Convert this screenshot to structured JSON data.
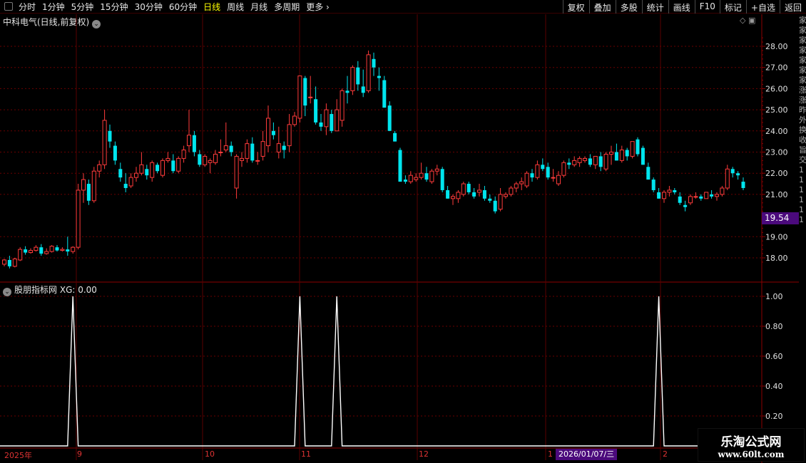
{
  "toolbar": {
    "periods": [
      "分时",
      "1分钟",
      "5分钟",
      "15分钟",
      "30分钟",
      "60分钟",
      "日线",
      "周线",
      "月线",
      "多周期"
    ],
    "active_period": "日线",
    "more_label": "更多",
    "more_icon": "chevron-right-icon",
    "buttons": [
      "复权",
      "叠加",
      "多股",
      "统计",
      "画线",
      "F10",
      "标记",
      "+自选",
      "返回"
    ]
  },
  "main_chart": {
    "title": "中科电气(日线,前复权)",
    "y_ticks": [
      "28.00",
      "27.00",
      "26.00",
      "25.00",
      "24.00",
      "23.00",
      "22.00",
      "21.00",
      "19.00",
      "18.00"
    ],
    "current_price": "19.54",
    "colors": {
      "up": "#ff3b3b",
      "down": "#00e5ee",
      "grid": "#6a0000",
      "price_badge": "#4b0a7c"
    }
  },
  "indicator": {
    "title": "股朋指标网",
    "value_label": "XG: 0.00",
    "y_ticks": [
      "1.00",
      "0.80",
      "0.60",
      "0.40",
      "0.20"
    ],
    "line_color": "#ffffff"
  },
  "x_axis": {
    "labels": [
      "2025年",
      "9",
      "10",
      "11",
      "12",
      "1",
      "2"
    ],
    "crosshair_date": "2026/01/07/三"
  },
  "right_strip": [
    "家",
    "家",
    "家",
    "家",
    "家",
    "家",
    "家",
    "涨",
    "涨",
    "昨",
    "外",
    "换",
    "收",
    "旨",
    "交",
    "1",
    "1",
    "1",
    "1",
    "1",
    "1"
  ],
  "watermark": {
    "title": "乐淘公式网",
    "url": "www.60lt.com"
  },
  "chart_data": [
    {
      "type": "candlestick",
      "title": "中科电气(日线,前复权)",
      "ylim": [
        17.5,
        28.5
      ],
      "y_ticks": [
        28,
        27,
        26,
        25,
        24,
        23,
        22,
        21,
        19,
        18
      ],
      "x_labels": [
        "2025年",
        "9",
        "10",
        "11",
        "12",
        "1",
        "2"
      ],
      "last_price": 19.54,
      "ohlc": [
        [
          17.7,
          17.95,
          17.6,
          17.9
        ],
        [
          17.9,
          18.1,
          17.5,
          17.6
        ],
        [
          17.6,
          18.0,
          17.55,
          17.95
        ],
        [
          17.9,
          18.5,
          17.85,
          18.4
        ],
        [
          18.4,
          18.55,
          18.15,
          18.25
        ],
        [
          18.25,
          18.45,
          18.2,
          18.35
        ],
        [
          18.35,
          18.6,
          18.3,
          18.5
        ],
        [
          18.5,
          18.65,
          18.1,
          18.2
        ],
        [
          18.2,
          18.45,
          18.15,
          18.3
        ],
        [
          18.3,
          18.6,
          18.25,
          18.55
        ],
        [
          18.5,
          18.6,
          18.3,
          18.35
        ],
        [
          18.35,
          18.5,
          18.3,
          18.4
        ],
        [
          18.4,
          19.0,
          18.1,
          18.3
        ],
        [
          18.3,
          18.55,
          18.2,
          18.5
        ],
        [
          18.5,
          21.5,
          18.4,
          21.2
        ],
        [
          21.2,
          22.0,
          20.6,
          21.7
        ],
        [
          21.5,
          21.7,
          20.5,
          20.7
        ],
        [
          20.7,
          22.3,
          20.6,
          22.1
        ],
        [
          22.1,
          22.6,
          21.8,
          22.4
        ],
        [
          22.4,
          25.0,
          22.2,
          24.5
        ],
        [
          24.0,
          24.3,
          23.2,
          23.5
        ],
        [
          23.3,
          23.5,
          22.4,
          22.6
        ],
        [
          22.2,
          22.5,
          21.6,
          21.8
        ],
        [
          21.5,
          22.0,
          21.1,
          21.3
        ],
        [
          21.4,
          22.0,
          21.3,
          21.8
        ],
        [
          21.8,
          22.3,
          21.6,
          22.0
        ],
        [
          22.0,
          23.0,
          21.9,
          22.4
        ],
        [
          22.2,
          22.4,
          21.7,
          21.9
        ],
        [
          21.8,
          22.6,
          21.6,
          22.5
        ],
        [
          22.4,
          22.5,
          22.0,
          22.1
        ],
        [
          21.9,
          22.7,
          21.8,
          22.6
        ],
        [
          22.6,
          23.0,
          22.5,
          22.7
        ],
        [
          22.6,
          22.9,
          22.0,
          22.1
        ],
        [
          22.1,
          22.8,
          22.0,
          22.7
        ],
        [
          22.7,
          23.3,
          22.5,
          23.1
        ],
        [
          23.3,
          25.0,
          23.0,
          23.8
        ],
        [
          23.8,
          24.0,
          22.8,
          23.0
        ],
        [
          22.9,
          23.1,
          22.3,
          22.4
        ],
        [
          22.4,
          22.9,
          22.3,
          22.8
        ],
        [
          22.5,
          22.7,
          22.0,
          22.6
        ],
        [
          22.5,
          23.1,
          22.4,
          22.9
        ],
        [
          23.0,
          23.6,
          22.8,
          23.0
        ],
        [
          23.1,
          24.4,
          23.0,
          23.3
        ],
        [
          23.3,
          23.5,
          22.8,
          23.0
        ],
        [
          21.3,
          22.9,
          20.8,
          22.8
        ],
        [
          22.6,
          23.0,
          22.3,
          22.7
        ],
        [
          22.7,
          23.6,
          22.5,
          23.4
        ],
        [
          23.4,
          23.7,
          22.5,
          22.6
        ],
        [
          22.6,
          23.0,
          22.4,
          22.6
        ],
        [
          22.8,
          24.0,
          22.6,
          23.5
        ],
        [
          23.3,
          25.2,
          23.0,
          24.6
        ],
        [
          24.0,
          24.4,
          23.6,
          23.8
        ],
        [
          23.0,
          24.2,
          22.7,
          23.4
        ],
        [
          23.3,
          23.5,
          22.7,
          23.1
        ],
        [
          23.3,
          24.8,
          23.0,
          24.3
        ],
        [
          24.3,
          24.9,
          24.2,
          24.7
        ],
        [
          24.6,
          26.6,
          24.4,
          26.6
        ],
        [
          26.5,
          26.6,
          24.7,
          25.2
        ],
        [
          25.6,
          26.6,
          25.3,
          25.6
        ],
        [
          25.5,
          26.1,
          24.3,
          24.4
        ],
        [
          24.4,
          24.8,
          24.0,
          24.2
        ],
        [
          24.2,
          25.3,
          23.8,
          25.0
        ],
        [
          24.8,
          25.0,
          23.9,
          24.0
        ],
        [
          24.0,
          25.5,
          24.3,
          25.0
        ],
        [
          24.5,
          26.0,
          24.2,
          25.9
        ],
        [
          25.9,
          26.6,
          25.3,
          25.8
        ],
        [
          25.9,
          27.1,
          25.7,
          27.0
        ],
        [
          27.0,
          27.3,
          25.9,
          26.2
        ],
        [
          26.1,
          26.9,
          25.6,
          25.8
        ],
        [
          25.9,
          27.8,
          25.8,
          27.6
        ],
        [
          27.4,
          27.7,
          26.6,
          27.0
        ],
        [
          26.6,
          27.0,
          25.9,
          26.5
        ],
        [
          26.4,
          26.6,
          25.1,
          25.1
        ],
        [
          25.2,
          25.4,
          24.0,
          24.0
        ],
        [
          23.9,
          24.0,
          23.5,
          23.5
        ],
        [
          23.1,
          23.2,
          21.6,
          21.6
        ],
        [
          21.7,
          21.9,
          21.5,
          21.6
        ],
        [
          21.6,
          22.1,
          21.5,
          21.9
        ],
        [
          21.7,
          22.0,
          21.6,
          21.8
        ],
        [
          21.8,
          22.5,
          21.7,
          22.0
        ],
        [
          22.0,
          22.3,
          21.6,
          21.7
        ],
        [
          21.6,
          22.2,
          21.5,
          22.1
        ],
        [
          22.1,
          22.4,
          21.9,
          22.2
        ],
        [
          22.2,
          22.3,
          21.1,
          21.2
        ],
        [
          21.2,
          21.4,
          20.8,
          20.8
        ],
        [
          20.8,
          21.0,
          20.5,
          20.9
        ],
        [
          20.8,
          21.2,
          20.6,
          21.1
        ],
        [
          21.0,
          21.6,
          20.9,
          21.5
        ],
        [
          21.5,
          21.6,
          21.0,
          21.1
        ],
        [
          21.1,
          21.3,
          20.8,
          20.9
        ],
        [
          21.1,
          21.5,
          20.9,
          21.2
        ],
        [
          21.2,
          21.4,
          20.7,
          20.8
        ],
        [
          20.8,
          21.0,
          20.6,
          20.7
        ],
        [
          20.7,
          20.9,
          20.1,
          20.2
        ],
        [
          20.3,
          21.3,
          20.2,
          21.0
        ],
        [
          20.9,
          21.1,
          20.8,
          21.0
        ],
        [
          21.0,
          21.4,
          20.9,
          21.3
        ],
        [
          21.3,
          21.6,
          21.1,
          21.5
        ],
        [
          21.5,
          21.8,
          21.2,
          21.6
        ],
        [
          21.4,
          22.1,
          21.3,
          22.0
        ],
        [
          22.0,
          22.2,
          21.6,
          21.8
        ],
        [
          21.8,
          22.6,
          21.7,
          22.4
        ],
        [
          22.4,
          22.7,
          22.1,
          22.2
        ],
        [
          22.3,
          22.5,
          21.7,
          21.8
        ],
        [
          21.8,
          22.2,
          21.6,
          21.8
        ],
        [
          21.5,
          22.1,
          21.4,
          21.9
        ],
        [
          21.9,
          22.6,
          21.8,
          22.5
        ],
        [
          22.5,
          22.7,
          22.2,
          22.4
        ],
        [
          22.4,
          22.8,
          22.3,
          22.6
        ],
        [
          22.5,
          22.8,
          22.3,
          22.7
        ],
        [
          22.6,
          22.8,
          22.5,
          22.7
        ],
        [
          22.7,
          22.9,
          22.3,
          22.4
        ],
        [
          22.4,
          22.8,
          22.2,
          22.8
        ],
        [
          22.8,
          23.0,
          22.1,
          22.3
        ],
        [
          22.2,
          23.0,
          22.1,
          22.9
        ],
        [
          22.9,
          23.3,
          22.4,
          23.0
        ],
        [
          23.0,
          23.4,
          22.6,
          22.6
        ],
        [
          22.6,
          23.3,
          22.5,
          23.1
        ],
        [
          23.1,
          23.2,
          22.6,
          22.8
        ],
        [
          22.8,
          23.5,
          22.7,
          23.5
        ],
        [
          23.6,
          23.7,
          22.8,
          22.9
        ],
        [
          23.2,
          23.3,
          22.4,
          22.4
        ],
        [
          22.3,
          22.5,
          21.7,
          21.7
        ],
        [
          21.7,
          21.8,
          21.1,
          21.2
        ],
        [
          21.1,
          21.3,
          20.8,
          20.8
        ],
        [
          20.8,
          21.2,
          20.6,
          21.1
        ],
        [
          21.1,
          21.4,
          20.9,
          21.2
        ],
        [
          21.2,
          21.3,
          21.0,
          21.1
        ],
        [
          20.9,
          21.1,
          20.5,
          20.6
        ],
        [
          20.5,
          20.7,
          20.2,
          20.4
        ],
        [
          20.6,
          21.0,
          20.5,
          20.9
        ],
        [
          20.9,
          21.1,
          20.8,
          20.9
        ],
        [
          20.9,
          21.0,
          20.7,
          20.8
        ],
        [
          20.8,
          21.1,
          20.8,
          21.1
        ],
        [
          21.0,
          21.2,
          20.8,
          20.9
        ],
        [
          20.9,
          21.1,
          20.7,
          21.0
        ],
        [
          21.0,
          21.4,
          20.9,
          21.3
        ],
        [
          21.3,
          22.4,
          21.2,
          22.2
        ],
        [
          22.2,
          22.3,
          21.8,
          22.0
        ],
        [
          22.0,
          22.1,
          21.7,
          21.9
        ],
        [
          21.6,
          21.8,
          21.2,
          21.3
        ]
      ]
    },
    {
      "type": "line",
      "title": "股朋指标网",
      "series": [
        {
          "name": "XG",
          "spikes_at_candle_index": [
            13,
            56,
            63,
            124
          ]
        }
      ],
      "ylim": [
        0,
        1
      ],
      "y_ticks": [
        1.0,
        0.8,
        0.6,
        0.4,
        0.2
      ],
      "last_value": 0.0
    }
  ]
}
